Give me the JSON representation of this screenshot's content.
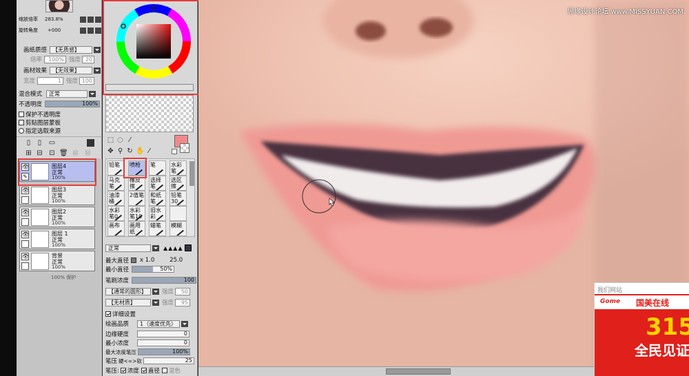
{
  "watermark": "思缘设计论坛 www.MISSYUAN.COM",
  "layer_panel": {
    "zoom_label": "缩放倍率",
    "zoom_value": "283.8%",
    "rotate_label": "旋转角度",
    "rotate_value": "+000",
    "paper_texture_label": "画纸质感",
    "paper_texture_value": "【无质感】",
    "texture_scale_label": "倍率",
    "texture_scale_value": "100%",
    "texture_strength_label": "强度",
    "texture_strength_value": "20",
    "paper_effect_label": "画材效果",
    "paper_effect_value": "【无效果】",
    "effect_width_label": "宽度",
    "effect_width_value": "1",
    "effect_strength_label": "强度",
    "effect_strength_value": "100",
    "blend_mode_label": "混合模式",
    "blend_mode_value": "正常",
    "opacity_label": "不透明度",
    "opacity_value": "100%",
    "opacity_fraction": 1.0,
    "protect_opacity": "保护不透明度",
    "clip_group": "剪贴图层蒙板",
    "selection_source": "指定选取来源",
    "layers": [
      {
        "name": "图层4",
        "mode": "正常",
        "opacity": "100%"
      },
      {
        "name": "图层3",
        "mode": "正常",
        "opacity": "100%"
      },
      {
        "name": "图层2",
        "mode": "正常",
        "opacity": "100%"
      },
      {
        "name": "图层 1",
        "mode": "正常",
        "opacity": "100%"
      },
      {
        "name": "背景",
        "mode": "正常",
        "opacity": "100%"
      }
    ],
    "bottom_text": "100% 保护"
  },
  "tool_panel": {
    "brushes": [
      [
        "铅笔",
        "喷枪",
        "笔",
        "水彩笔"
      ],
      [
        "马克笔",
        "橡皮擦",
        "选择笔",
        "选区擦"
      ],
      [
        "油漆桶",
        "2值笔",
        "和纸笔",
        "铅笔30"
      ],
      [
        "水彩笔0",
        "水彩笔10",
        "旧水彩",
        ""
      ],
      [
        "画布",
        "画用纸",
        "蜡笔",
        "模糊"
      ]
    ],
    "draw_mode_value": "正常",
    "max_size_label": "最大直径",
    "max_size_multiplier": "x 1.0",
    "max_size_value": "25.0",
    "min_size_label": "最小直径",
    "min_size_value": "50%",
    "min_size_fraction": 0.5,
    "density_label": "笔刷浓度",
    "density_value": "100",
    "density_fraction": 1.0,
    "shape_value": "【通常的圆形】",
    "shape_strength_label": "强度",
    "shape_strength_value": "50",
    "texture_value": "【无材质】",
    "texture_strength_label": "强度",
    "texture_strength_value": "95",
    "detail_settings": "详细设置",
    "quality_label": "绘画品质",
    "quality_value": "1（速度优先）",
    "edge_hardness_label": "边缘硬度",
    "edge_hardness_value": "0",
    "min_density_label": "最小浓度",
    "min_density_value": "0",
    "max_density_pressure_label": "最大浓度笔压",
    "max_density_pressure_value": "100%",
    "max_density_pressure_fraction": 1.0,
    "pressure_hard_label": "笔压",
    "pressure_hard_soft": "硬<=>软",
    "pressure_hard_value": "25",
    "pen_pressure_label": "笔压:",
    "pen_density": "浓度",
    "pen_size": "直径",
    "pen_blend": "混色"
  },
  "colors": {
    "foreground": "#f08a8a",
    "highlight": "#e23c3c",
    "selected_layer": "#b8bff0"
  },
  "ad": {
    "header": "我们网站",
    "logo": "Gome",
    "title": "国美在线",
    "number": "315",
    "slogan": "全民见证"
  }
}
